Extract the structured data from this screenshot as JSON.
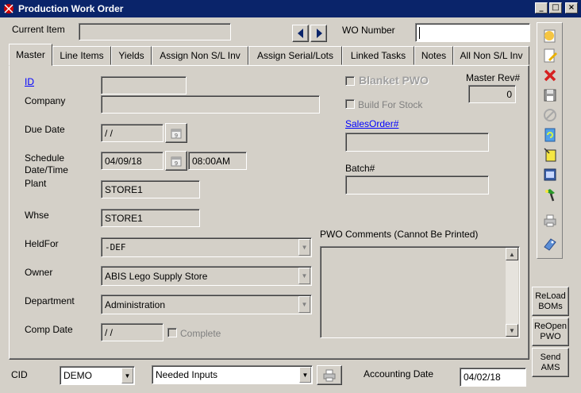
{
  "window": {
    "title": "Production Work Order",
    "controls": {
      "minimize": "_",
      "maximize": "□",
      "close": "×"
    }
  },
  "header": {
    "current_item_label": "Current Item",
    "current_item_value": "",
    "wo_number_label": "WO Number",
    "wo_number_value": ""
  },
  "tabs": [
    {
      "label": "Master",
      "active": true
    },
    {
      "label": "Line Items"
    },
    {
      "label": "Yields"
    },
    {
      "label": "Assign  Non S/L Inv"
    },
    {
      "label": "Assign Serial/Lots"
    },
    {
      "label": "Linked Tasks"
    },
    {
      "label": "Notes"
    },
    {
      "label": "All Non S/L Inv"
    }
  ],
  "master": {
    "id_label": "ID",
    "id_value": "",
    "company_label": "Company",
    "company_value": "",
    "due_date_label": "Due Date",
    "due_date_value": " / /",
    "schedule_label_1": "Schedule",
    "schedule_label_2": "Date/Time",
    "schedule_date": "04/09/18",
    "schedule_time": "08:00AM",
    "plant_label": "Plant",
    "plant_value": "STORE1",
    "whse_label": "Whse",
    "whse_value": "STORE1",
    "heldfor_label": "HeldFor",
    "heldfor_value": "-DEF",
    "owner_label": "Owner",
    "owner_value": "ABIS Lego Supply Store",
    "department_label": "Department",
    "department_value": "Administration",
    "comp_date_label": "Comp Date",
    "comp_date_value": " / /",
    "complete_label": "Complete",
    "blanket_pwo_label": "Blanket PWO",
    "master_rev_label": "Master Rev#",
    "master_rev_value": "0",
    "build_for_stock_label": "Build For Stock",
    "sales_order_label": "SalesOrder#",
    "sales_order_value": "",
    "batch_label": "Batch#",
    "batch_value": "",
    "pwo_comments_label": "PWO Comments  (Cannot Be Printed)",
    "pwo_comments_value": ""
  },
  "side_buttons": {
    "reload_line1": "ReLoad",
    "reload_line2": "BOMs",
    "reopen_line1": "ReOpen",
    "reopen_line2": "PWO",
    "send_line1": "Send",
    "send_line2": "AMS"
  },
  "footer": {
    "cid_label": "CID",
    "cid_value": "DEMO",
    "report_value": "Needed Inputs",
    "accounting_date_label": "Accounting Date",
    "accounting_date_value": "04/02/18"
  },
  "toolbar_icons": [
    "new-record-icon",
    "edit-icon",
    "delete-icon",
    "save-icon",
    "cancel-icon",
    "refresh-icon",
    "copy-icon",
    "card-icon",
    "tools-icon",
    "print-icon",
    "tag-icon"
  ],
  "colors": {
    "window_face": "#d4d0c8",
    "title_bar": "#0a246a",
    "link": "#0000ff"
  }
}
